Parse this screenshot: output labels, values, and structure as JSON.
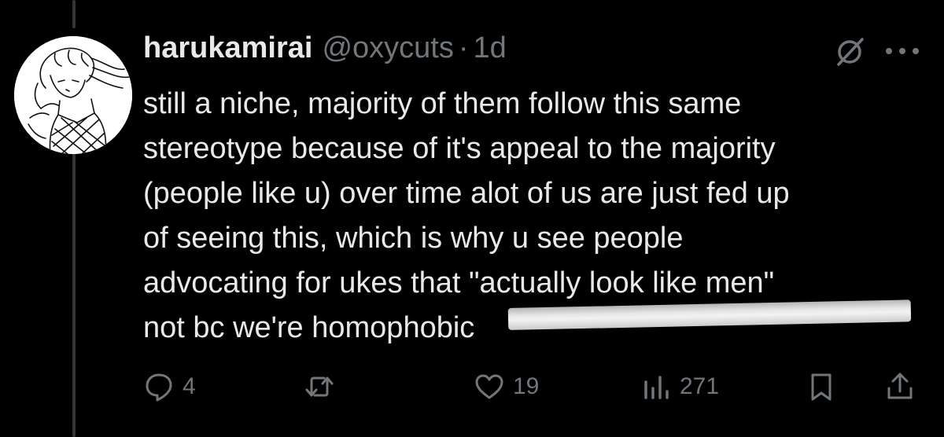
{
  "tweet": {
    "display_name": "harukamirai",
    "handle": "@oxycuts",
    "separator": "·",
    "time": "1d",
    "body_lines": [
      "still a niche, majority of them follow this same",
      "stereotype because of it's appeal to the majority",
      "(people like u) over time alot of us are just fed up",
      "of seeing this, which is why u see people",
      "advocating for ukes that \"actually look like men\"",
      "not bc we're homophobic"
    ]
  },
  "actions": {
    "replies": "4",
    "reposts": "",
    "likes": "19",
    "views": "271"
  },
  "icons": {
    "avatar": "avatar-icon",
    "grok": "grok-icon",
    "more": "more-icon",
    "reply": "reply-icon",
    "repost": "repost-icon",
    "like": "heart-icon",
    "views": "analytics-icon",
    "bookmark": "bookmark-icon",
    "share": "share-icon"
  },
  "colors": {
    "background": "#000000",
    "text": "#e7e9ea",
    "secondary": "#71767b",
    "thread_line": "#333639"
  }
}
